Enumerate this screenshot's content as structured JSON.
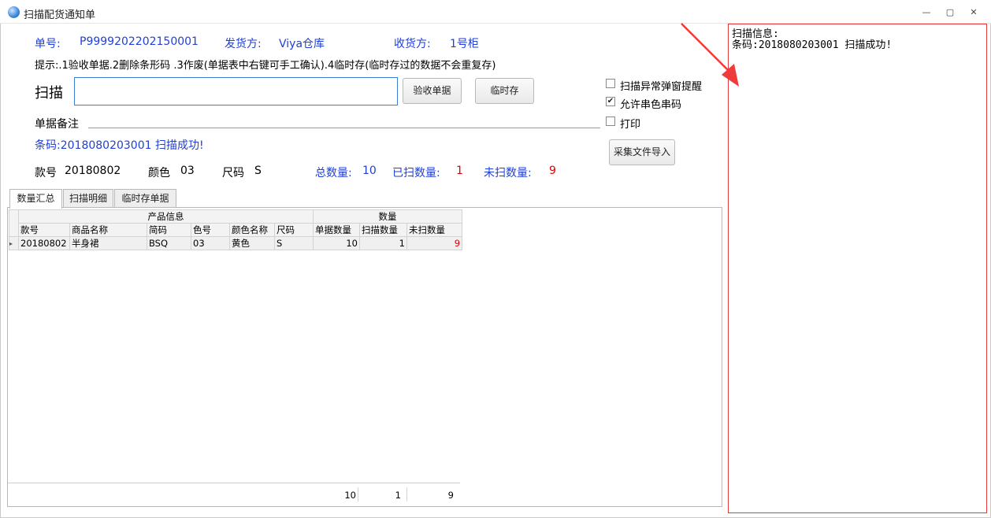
{
  "window": {
    "title": "扫描配货通知单",
    "minimize_glyph": "—",
    "maximize_glyph": "▢",
    "close_glyph": "✕"
  },
  "header": {
    "order_label": "单号:",
    "order_value": "P9999202202150001",
    "shipper_label": "发货方:",
    "shipper_value": "Viya仓库",
    "receiver_label": "收货方:",
    "receiver_value": "1号柜"
  },
  "tip": "提示:.1验收单据.2删除条形码 .3作废(单据表中右键可手工确认).4临时存(临时存过的数据不会重复存)",
  "scan": {
    "label": "扫描",
    "value": "",
    "accept_button": "验收单据",
    "temp_save_button": "临时存"
  },
  "memo": {
    "label": "单据备注"
  },
  "status_message": "条码:2018080203001 扫描成功!",
  "options": {
    "popup_alert": {
      "label": "扫描异常弹窗提醒",
      "checked": false
    },
    "allow_cross_color": {
      "label": "允许串色串码",
      "checked": true
    },
    "print": {
      "label": "打印",
      "checked": false
    },
    "checked_glyph": "✔",
    "import_button": "采集文件导入"
  },
  "info": {
    "style_label": "款号",
    "style_value": "20180802",
    "color_label": "颜色",
    "color_value": "03",
    "size_label": "尺码",
    "size_value": "S",
    "total_label": "总数量:",
    "total_value": "10",
    "scanned_label": "已扫数量:",
    "scanned_value": "1",
    "unscanned_label": "未扫数量:",
    "unscanned_value": "9"
  },
  "tabs": [
    {
      "label": "数量汇总",
      "active": true
    },
    {
      "label": "扫描明细",
      "active": false
    },
    {
      "label": "临时存单据",
      "active": false
    }
  ],
  "grid": {
    "group_product": "产品信息",
    "group_quantity": "数量",
    "columns": [
      "款号",
      "商品名称",
      "简码",
      "色号",
      "颜色名称",
      "尺码",
      "单据数量",
      "扫描数量",
      "未扫数量"
    ],
    "rows": [
      [
        "20180802",
        "半身裙",
        "BSQ",
        "03",
        "黄色",
        "S",
        "10",
        "1",
        "9"
      ]
    ],
    "row_indicator": "▸",
    "totals": {
      "doc_qty": "10",
      "scan_qty": "1",
      "unscanned_qty": "9"
    }
  },
  "scan_info": {
    "title": "扫描信息:",
    "line": "条码:2018080203001 扫描成功!"
  },
  "colors": {
    "accent_blue": "#1f3fd6",
    "alert_red": "#e00000",
    "panel_border": "#e23a3a",
    "arrow": "#ef3b3b"
  }
}
